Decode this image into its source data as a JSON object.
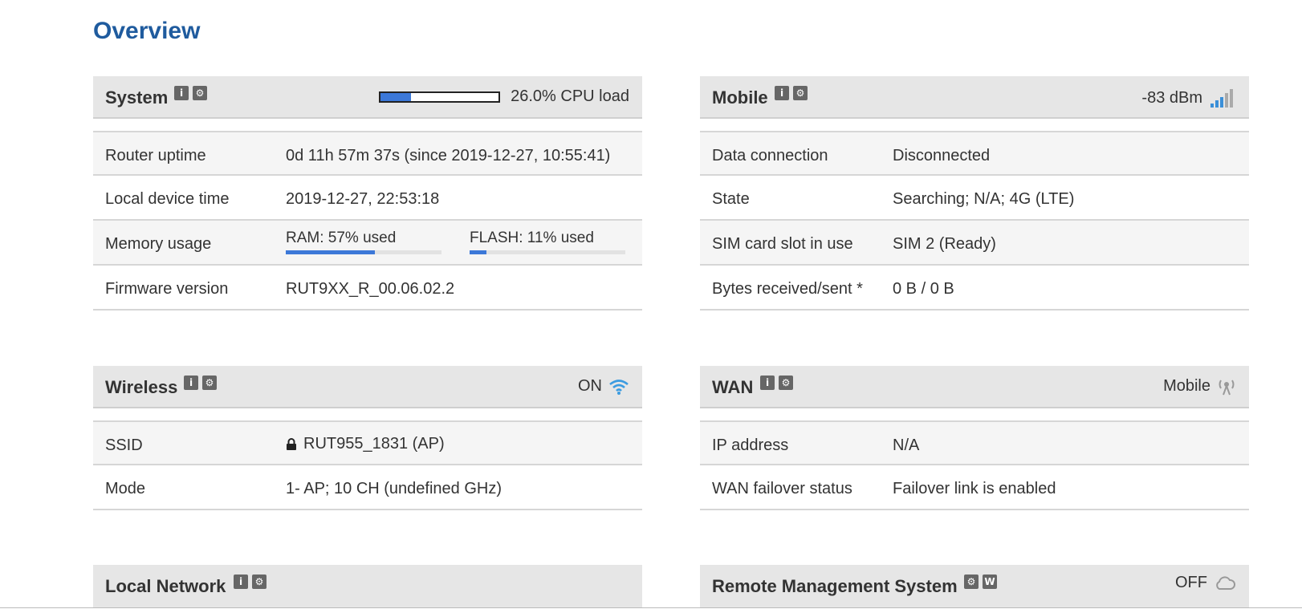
{
  "page": {
    "title": "Overview"
  },
  "icons": {
    "info": "i",
    "settings": "⚙",
    "web": "W"
  },
  "colors": {
    "accent": "#1f5b9e",
    "bar": "#3c78d8",
    "wifi": "#3b9be0"
  },
  "system": {
    "title": "System",
    "cpu_load_fraction": 0.26,
    "cpu_text": "26.0% CPU load",
    "rows": [
      {
        "label": "Router uptime",
        "value": "0d 11h 57m 37s (since 2019-12-27, 10:55:41)"
      },
      {
        "label": "Local device time",
        "value": "2019-12-27, 22:53:18"
      },
      {
        "label": "Memory usage"
      },
      {
        "label": "Firmware version",
        "value": "RUT9XX_R_00.06.02.2"
      }
    ],
    "memory": {
      "ram_text": "RAM: 57% used",
      "ram_fraction": 0.57,
      "flash_text": "FLASH: 11% used",
      "flash_fraction": 0.11
    }
  },
  "mobile": {
    "title": "Mobile",
    "signal_text": "-83 dBm",
    "signal_icon": "signal-bars-icon",
    "rows": [
      {
        "label": "Data connection",
        "value": "Disconnected"
      },
      {
        "label": "State",
        "value": "Searching; N/A; 4G (LTE)"
      },
      {
        "label": "SIM card slot in use",
        "value": "SIM 2 (Ready)"
      },
      {
        "label": "Bytes received/sent *",
        "value": "0 B / 0 B"
      }
    ]
  },
  "wireless": {
    "title": "Wireless",
    "status": "ON",
    "status_icon": "wifi-icon",
    "rows": [
      {
        "label": "SSID",
        "value": "RUT955_1831 (AP)"
      },
      {
        "label": "Mode",
        "value": "1- AP; 10 CH (undefined GHz)"
      }
    ]
  },
  "wan": {
    "title": "WAN",
    "status": "Mobile",
    "status_icon": "antenna-icon",
    "rows": [
      {
        "label": "IP address",
        "value": "N/A"
      },
      {
        "label": "WAN failover status",
        "value": "Failover link is enabled"
      }
    ]
  },
  "local_network": {
    "title": "Local Network"
  },
  "rms": {
    "title": "Remote Management System",
    "status": "OFF",
    "status_icon": "cloud-icon"
  }
}
